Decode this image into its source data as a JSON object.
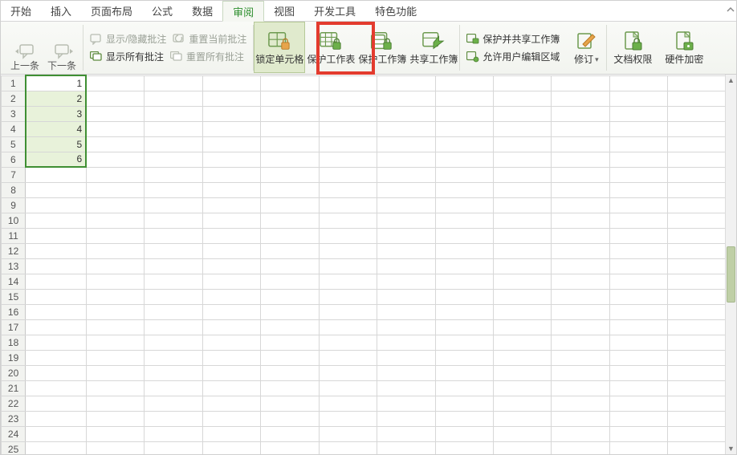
{
  "tabs": {
    "start": "开始",
    "insert": "插入",
    "layout": "页面布局",
    "formula": "公式",
    "data": "数据",
    "review": "审阅",
    "view": "视图",
    "dev": "开发工具",
    "feature": "特色功能"
  },
  "ribbon": {
    "nav_prev": "上一条",
    "nav_next": "下一条",
    "show_hide_comment": "显示/隐藏批注",
    "show_all_comments": "显示所有批注",
    "reset_current_comment": "重置当前批注",
    "reset_all_comments": "重置所有批注",
    "lock_cells": "锁定单元格",
    "protect_sheet": "保护工作表",
    "protect_workbook": "保护工作簿",
    "share_workbook": "共享工作簿",
    "protect_share_workbook": "保护并共享工作簿",
    "allow_users_edit_ranges": "允许用户编辑区域",
    "revisions": "修订",
    "doc_permissions": "文档权限",
    "hw_encrypt": "硬件加密"
  },
  "sheet": {
    "rows": 25,
    "cols": 12,
    "colA_width": 75,
    "other_col_width": 72,
    "values": {
      "A1": "1",
      "A2": "2",
      "A3": "3",
      "A4": "4",
      "A5": "5",
      "A6": "6"
    },
    "selection": {
      "col": "A",
      "row_start": 1,
      "row_end": 6,
      "active_row": 1
    }
  }
}
